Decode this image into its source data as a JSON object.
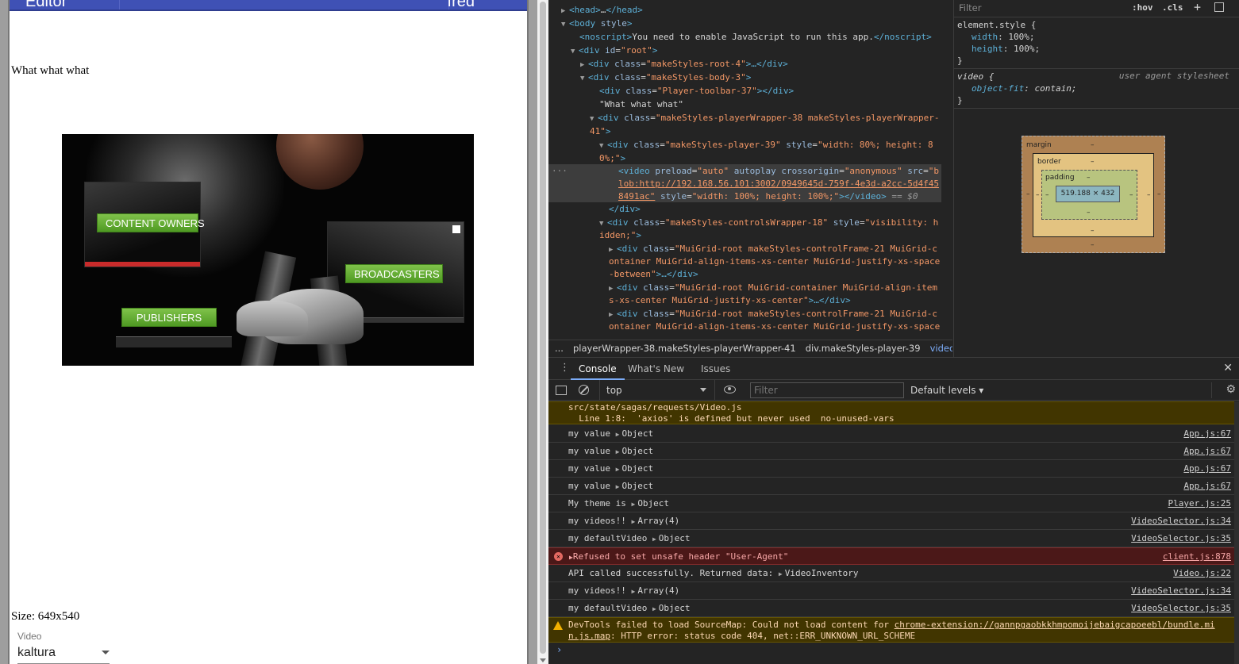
{
  "app": {
    "title": "Editor",
    "user": "fred",
    "body_text": "What what what",
    "size_text": "Size: 649x540",
    "video_label": "Video",
    "video_selected": "kaltura",
    "video_buttons": {
      "owners": "CONTENT OWNERS",
      "broadcasters": "BROADCASTERS",
      "publishers": "PUBLISHERS"
    }
  },
  "devtools": {
    "elements": {
      "line1": {
        "tag": "<head>",
        "mid": "…",
        "close": "</head>"
      },
      "line2": {
        "tag": "<body ",
        "attr": "style",
        "close": ">"
      },
      "line3": {
        "open": "<noscript>",
        "text": "You need to enable JavaScript to run this app.",
        "close": "</noscript>"
      },
      "line4": {
        "open": "<div ",
        "attr": "id",
        "eq": "=",
        "val": "\"root\"",
        "close": ">"
      },
      "line5": {
        "open": "<div ",
        "attr": "class",
        "eq": "=",
        "val": "\"makeStyles-root-4\"",
        "close": ">…</div>"
      },
      "line6": {
        "open": "<div ",
        "attr": "class",
        "eq": "=",
        "val": "\"makeStyles-body-3\"",
        "close": ">"
      },
      "line7": {
        "open": "<div ",
        "attr": "class",
        "eq": "=",
        "val": "\"Player-toolbar-37\"",
        "close": "></div>"
      },
      "line8": {
        "text": "\"What what what\""
      },
      "line9": {
        "open": "<div ",
        "attr": "class",
        "eq": "=",
        "val": "\"makeStyles-playerWrapper-38 makeStyles-playerWrapper-"
      },
      "line10": {
        "val": "41\"",
        "close": ">"
      },
      "line11": {
        "open": "<div ",
        "attr": "class",
        "eq": "=",
        "val": "\"makeStyles-player-39\"",
        "attr2": " style",
        "eq2": "=",
        "val2": "\"width: 80%; height: 8"
      },
      "line12": {
        "val": "0%;\"",
        "close": ">"
      },
      "line13": {
        "open": "<video ",
        "a1": "preload",
        "v1": "\"auto\"",
        "a2": " autoplay",
        "a3": " crossorigin",
        "v3": "\"anonymous\"",
        "a4": " src",
        "v4": "\"b"
      },
      "line14": {
        "v": "lob:http://192.168.56.101:3002/0949645d-759f-4e3d-a2cc-5d4f45"
      },
      "line15": {
        "v": "8491ac\"",
        "a": " style",
        "v2": "\"width: 100%; height: 100%;\"",
        "close": "></video>",
        "dollar": " == $0"
      },
      "line16": {
        "close": "</div>"
      },
      "line17": {
        "open": "<div ",
        "attr": "class",
        "eq": "=",
        "val": "\"makeStyles-controlsWrapper-18\"",
        "attr2": " style",
        "eq2": "=",
        "val2": "\"visibility: h"
      },
      "line18": {
        "val": "idden;\"",
        "close": ">"
      },
      "line19": {
        "open": "<div ",
        "attr": "class",
        "eq": "=",
        "val": "\"MuiGrid-root makeStyles-controlFrame-21 MuiGrid-c"
      },
      "line20": {
        "val": "ontainer MuiGrid-align-items-xs-center MuiGrid-justify-xs-space"
      },
      "line21": {
        "val": "-between\"",
        "close": ">…</div>"
      },
      "line22": {
        "open": "<div ",
        "attr": "class",
        "eq": "=",
        "val": "\"MuiGrid-root MuiGrid-container MuiGrid-align-item"
      },
      "line23": {
        "val": "s-xs-center MuiGrid-justify-xs-center\"",
        "close": ">…</div>"
      },
      "line24": {
        "open": "<div ",
        "attr": "class",
        "eq": "=",
        "val": "\"MuiGrid-root makeStyles-controlFrame-21 MuiGrid-c"
      },
      "line25": {
        "val": "ontainer MuiGrid-align-items-xs-center MuiGrid-justify-xs-space"
      }
    },
    "breadcrumbs": {
      "more": "...",
      "c1": "playerWrapper-38.makeStyles-playerWrapper-41",
      "c2": "div.makeStyles-player-39",
      "c3": "video",
      "more2": "..."
    },
    "styles": {
      "filter_placeholder": "Filter",
      "hov": ":hov",
      "cls": ".cls",
      "plus": "+",
      "element_style": "element.style {",
      "width_prop": "width",
      "width_val": "100%;",
      "height_prop": "height",
      "height_val": "100%;",
      "brace_close": "}",
      "video_selector": "video {",
      "ua_label": "user agent stylesheet",
      "object_fit_prop": "object-fit",
      "object_fit_val": "contain;",
      "box_margin": "margin",
      "box_border": "border",
      "box_padding": "padding",
      "box_content": "519.188 × 432",
      "dash": "–"
    },
    "drawer": {
      "tabs": [
        "Console",
        "What's New",
        "Issues"
      ],
      "context": "top",
      "filter_placeholder": "Filter",
      "levels": "Default levels ▾",
      "close": "✕",
      "gear": "⚙",
      "messages": [
        {
          "kind": "warn-cont",
          "line1": "src/state/sagas/requests/Video.js",
          "line2": "  Line 1:8:  'axios' is defined but never used  no-unused-vars"
        },
        {
          "kind": "log",
          "label": "my value ",
          "obj": "Object",
          "src": "App.js:67"
        },
        {
          "kind": "log",
          "label": "my value ",
          "obj": "Object",
          "src": "App.js:67"
        },
        {
          "kind": "log",
          "label": "my value ",
          "obj": "Object",
          "src": "App.js:67"
        },
        {
          "kind": "log",
          "label": "my value ",
          "obj": "Object",
          "src": "App.js:67"
        },
        {
          "kind": "log",
          "label": "My theme is ",
          "obj": "Object",
          "src": "Player.js:25"
        },
        {
          "kind": "log",
          "label": "my videos!! ",
          "obj": "Array(4)",
          "src": "VideoSelector.js:34"
        },
        {
          "kind": "log",
          "label": "my defaultVideo ",
          "obj": "Object",
          "src": "VideoSelector.js:35"
        },
        {
          "kind": "error",
          "label": "Refused to set unsafe header \"User-Agent\"",
          "src": "client.js:878"
        },
        {
          "kind": "log",
          "label": "API called successfully. Returned data: ",
          "obj": "VideoInventory",
          "src": "Video.js:22"
        },
        {
          "kind": "log",
          "label": "my videos!! ",
          "obj": "Array(4)",
          "src": "VideoSelector.js:34"
        },
        {
          "kind": "log",
          "label": "my defaultVideo ",
          "obj": "Object",
          "src": "VideoSelector.js:35"
        },
        {
          "kind": "warn",
          "line1a": "DevTools failed to load SourceMap: Could not load content for ",
          "link1": "chrome-extension://gannpgaobkkhmpomoijebaigcapoeebl/bundle.mi",
          "link2": "n.js.map",
          "line2b": ": HTTP error: status code 404, net::ERR_UNKNOWN_URL_SCHEME"
        }
      ],
      "prompt": "›"
    }
  }
}
